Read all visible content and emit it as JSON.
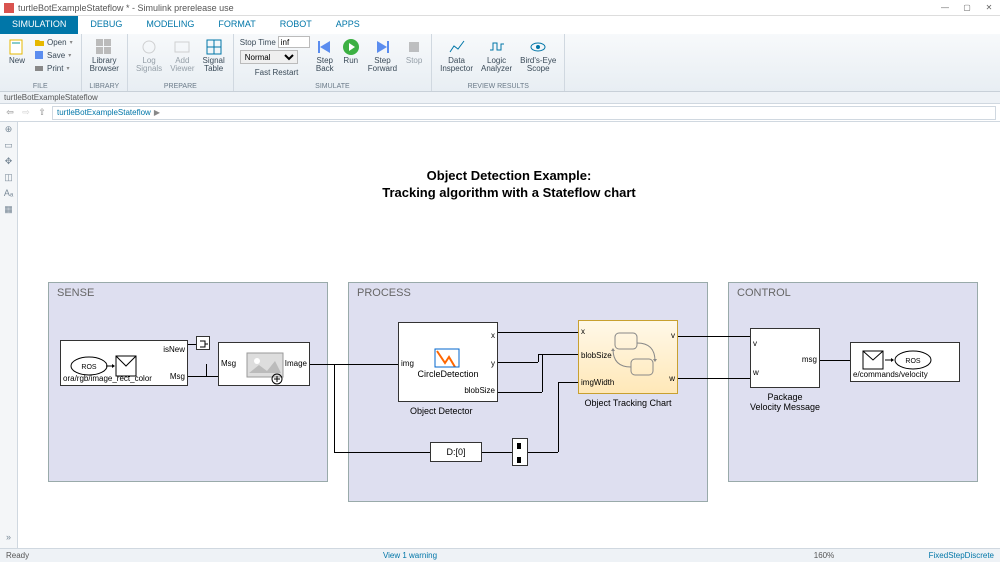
{
  "window": {
    "title": "turtleBotExampleStateflow * - Simulink prerelease use",
    "min": "—",
    "max": "▢",
    "close": "✕"
  },
  "tabs": [
    "SIMULATION",
    "DEBUG",
    "MODELING",
    "FORMAT",
    "ROBOT",
    "APPS"
  ],
  "active_tab": 0,
  "ribbon": {
    "file": {
      "new": "New",
      "open": "Open",
      "save": "Save",
      "print": "Print",
      "group": "FILE"
    },
    "library": {
      "lib": "Library\nBrowser",
      "group": "LIBRARY"
    },
    "prepare": {
      "log": "Log\nSignals",
      "add": "Add\nViewer",
      "table": "Signal\nTable",
      "group": "PREPARE"
    },
    "simulate": {
      "stoptime_label": "Stop Time",
      "stoptime": "inf",
      "mode": "Normal",
      "fastrestart": "Fast Restart",
      "stepback": "Step\nBack",
      "run": "Run",
      "stepfwd": "Step\nForward",
      "stop": "Stop",
      "group": "SIMULATE"
    },
    "review": {
      "data": "Data\nInspector",
      "logic": "Logic\nAnalyzer",
      "birds": "Bird's-Eye\nScope",
      "group": "REVIEW RESULTS"
    }
  },
  "explorer_bar": "turtleBotExampleStateflow",
  "breadcrumb": {
    "item": "turtleBotExampleStateflow",
    "sep": "▶"
  },
  "diagram": {
    "title_line1": "Object Detection Example:",
    "title_line2": "Tracking algorithm with a Stateflow chart",
    "sections": {
      "sense": "SENSE",
      "process": "PROCESS",
      "control": "CONTROL"
    },
    "blocks": {
      "sub_in": "ora/rgb/image_rect_color",
      "sub_isnew": "isNew",
      "sub_msg": "Msg",
      "ros_in": "ROS",
      "imgread_in": "Msg",
      "imgread_out": "Image",
      "detector_label": "Object Detector",
      "detector_name": "CircleDetection",
      "detector_in": "img",
      "detector_x": "x",
      "detector_y": "y",
      "detector_blob": "blobSize",
      "dwidth": "D:[0]",
      "chart_label": "Object Tracking Chart",
      "chart_x": "x",
      "chart_blob": "blobSize",
      "chart_imgw": "imgWidth",
      "chart_v": "v",
      "chart_w": "w",
      "pkg_label": "Package\nVelocity Message",
      "pkg_v": "v",
      "pkg_w": "w",
      "pkg_msg": "msg",
      "pub_topic": "e/commands/velocity",
      "ros_out": "ROS"
    }
  },
  "status": {
    "ready": "Ready",
    "warning": "View 1 warning",
    "zoom": "160%",
    "solver": "FixedStepDiscrete"
  }
}
